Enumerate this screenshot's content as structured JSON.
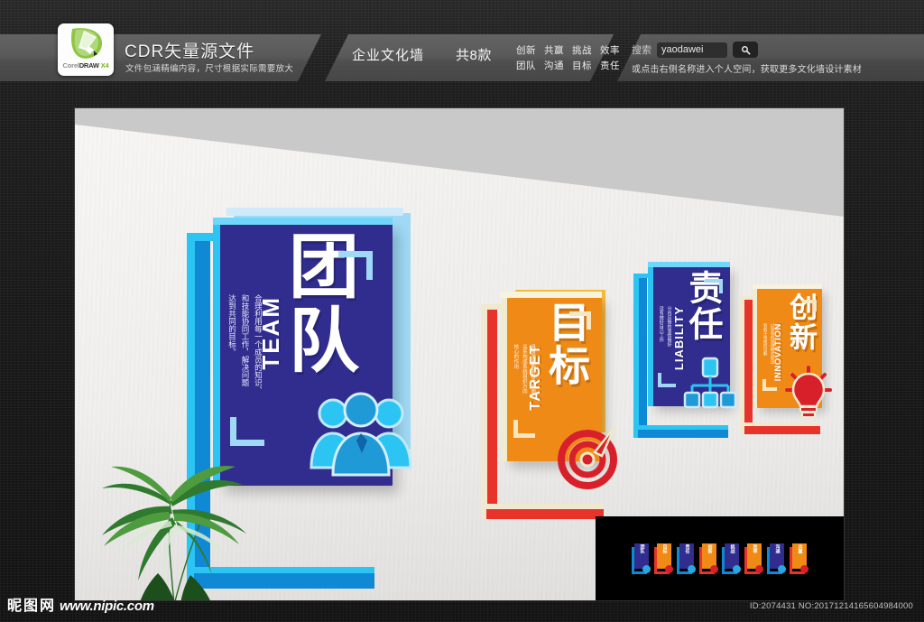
{
  "header": {
    "logo": {
      "part1": "Corel",
      "part2": "DRAW",
      "part3": "X4",
      "alt": "coreldraw-x4-logo"
    },
    "cdr_title": "CDR矢量源文件",
    "cdr_sub": "文件包涵精编内容，尺寸根据实际需要放大",
    "mid_title": "企业文化墙",
    "mid_count": "共8款",
    "tags": [
      "创新",
      "共赢",
      "挑战",
      "效率",
      "团队",
      "沟通",
      "目标",
      "责任"
    ],
    "search": {
      "label": "搜索",
      "value": "yaodawei",
      "placeholder": "yaodawei",
      "button_icon": "search-icon",
      "sub": "或点击右侧名称进入个人空间，获取更多文化墙设计素材"
    }
  },
  "scene": {
    "panels": [
      {
        "id": "team",
        "cn": "团队",
        "en": "TEAM",
        "desc_lines": [
          "合理利用每一个成员的知识、",
          "和技能协同工作，解决问题",
          "达到共同的目标。"
        ],
        "board_color": "#312d8f",
        "frame_color": "#1089d4",
        "frame_edge_color": "#2bc4f3",
        "accent_color": "#29a8e0",
        "icon": "team-people-icon"
      },
      {
        "id": "target",
        "cn": "目标",
        "en": "TARGET",
        "desc_lines": [
          "具有激系能够各个方面",
          "关系构成系统组织方向",
          "核心的作用"
        ],
        "board_color": "#f08a16",
        "frame_color": "#e8332a",
        "frame_edge_color": "#eae7cf",
        "accent_color": "#d8202a",
        "icon": "target-dartboard-icon"
      },
      {
        "id": "liability",
        "cn": "责任",
        "en": "LIABILITY",
        "desc_lines": [
          "分内应做的事情做好",
          "没有做好自己工作"
        ],
        "board_color": "#312d8f",
        "frame_color": "#1089d4",
        "frame_edge_color": "#2bc4f3",
        "accent_color": "#29a8e0",
        "icon": "org-chart-icon"
      },
      {
        "id": "innovation",
        "cn": "创新",
        "en": "INNOVATION",
        "desc_lines": [
          "以现有的思维模式提出",
          "有别于常规的见解"
        ],
        "board_color": "#f08a16",
        "frame_color": "#e8332a",
        "frame_edge_color": "#eae7cf",
        "accent_color": "#d8202a",
        "icon": "lightbulb-icon"
      }
    ],
    "plant": "potted-palm-plant"
  },
  "thumbnails": [
    {
      "label": "团队",
      "board": "#312d8f",
      "frame": "#1089d4",
      "icon": "#29a8e0"
    },
    {
      "label": "目标",
      "board": "#f08a16",
      "frame": "#e8332a",
      "icon": "#d8202a"
    },
    {
      "label": "责任",
      "board": "#312d8f",
      "frame": "#1089d4",
      "icon": "#29a8e0"
    },
    {
      "label": "创新",
      "board": "#f08a16",
      "frame": "#e8332a",
      "icon": "#d8202a"
    },
    {
      "label": "挑战",
      "board": "#312d8f",
      "frame": "#1089d4",
      "icon": "#29a8e0"
    },
    {
      "label": "效率",
      "board": "#f08a16",
      "frame": "#e8332a",
      "icon": "#d8202a"
    },
    {
      "label": "沟通",
      "board": "#312d8f",
      "frame": "#1089d4",
      "icon": "#29a8e0"
    },
    {
      "label": "共赢",
      "board": "#f08a16",
      "frame": "#e8332a",
      "icon": "#d8202a"
    }
  ],
  "footer": {
    "site_cn": "昵图网",
    "site_url": "www.nipic.com",
    "id_line": "ID:2074431 NO:20171214165604984000"
  }
}
